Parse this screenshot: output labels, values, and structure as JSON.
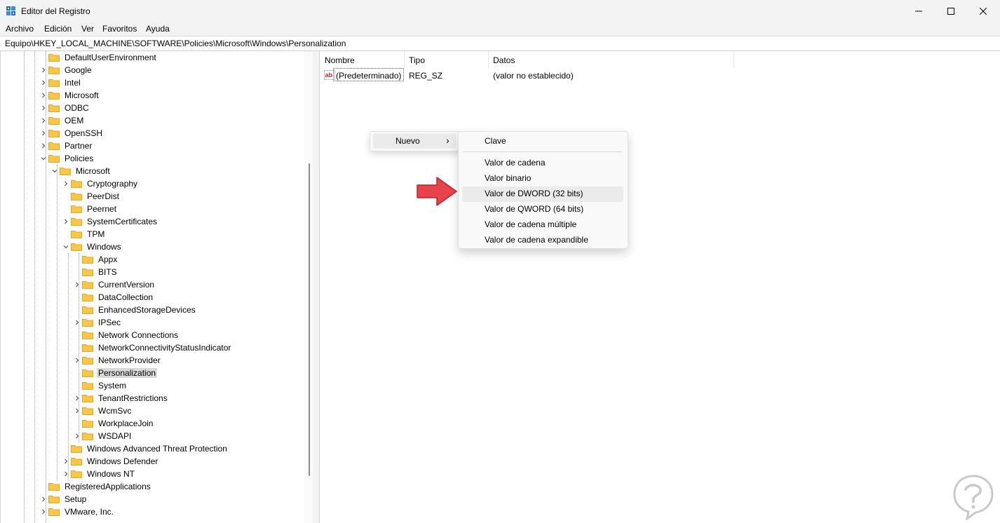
{
  "window": {
    "title": "Editor del Registro",
    "minimize": "—",
    "maximize": "☐",
    "close": "✕"
  },
  "menu": [
    "Archivo",
    "Edición",
    "Ver",
    "Favoritos",
    "Ayuda"
  ],
  "address": "Equipo\\HKEY_LOCAL_MACHINE\\SOFTWARE\\Policies\\Microsoft\\Windows\\Personalization",
  "tree": [
    {
      "label": "DefaultUserEnvironment",
      "level": 0,
      "expander": "none"
    },
    {
      "label": "Google",
      "level": 0,
      "expander": "collapsed"
    },
    {
      "label": "Intel",
      "level": 0,
      "expander": "collapsed"
    },
    {
      "label": "Microsoft",
      "level": 0,
      "expander": "collapsed"
    },
    {
      "label": "ODBC",
      "level": 0,
      "expander": "collapsed"
    },
    {
      "label": "OEM",
      "level": 0,
      "expander": "collapsed"
    },
    {
      "label": "OpenSSH",
      "level": 0,
      "expander": "collapsed"
    },
    {
      "label": "Partner",
      "level": 0,
      "expander": "collapsed"
    },
    {
      "label": "Policies",
      "level": 0,
      "expander": "expanded"
    },
    {
      "label": "Microsoft",
      "level": 1,
      "expander": "expanded"
    },
    {
      "label": "Cryptography",
      "level": 2,
      "expander": "collapsed"
    },
    {
      "label": "PeerDist",
      "level": 2,
      "expander": "none"
    },
    {
      "label": "Peernet",
      "level": 2,
      "expander": "none"
    },
    {
      "label": "SystemCertificates",
      "level": 2,
      "expander": "collapsed"
    },
    {
      "label": "TPM",
      "level": 2,
      "expander": "none"
    },
    {
      "label": "Windows",
      "level": 2,
      "expander": "expanded"
    },
    {
      "label": "Appx",
      "level": 3,
      "expander": "none"
    },
    {
      "label": "BITS",
      "level": 3,
      "expander": "none"
    },
    {
      "label": "CurrentVersion",
      "level": 3,
      "expander": "collapsed"
    },
    {
      "label": "DataCollection",
      "level": 3,
      "expander": "none"
    },
    {
      "label": "EnhancedStorageDevices",
      "level": 3,
      "expander": "none"
    },
    {
      "label": "IPSec",
      "level": 3,
      "expander": "collapsed"
    },
    {
      "label": "Network Connections",
      "level": 3,
      "expander": "none"
    },
    {
      "label": "NetworkConnectivityStatusIndicator",
      "level": 3,
      "expander": "none"
    },
    {
      "label": "NetworkProvider",
      "level": 3,
      "expander": "collapsed"
    },
    {
      "label": "Personalization",
      "level": 3,
      "expander": "none",
      "selected": true
    },
    {
      "label": "System",
      "level": 3,
      "expander": "none"
    },
    {
      "label": "TenantRestrictions",
      "level": 3,
      "expander": "collapsed"
    },
    {
      "label": "WcmSvc",
      "level": 3,
      "expander": "collapsed"
    },
    {
      "label": "WorkplaceJoin",
      "level": 3,
      "expander": "none"
    },
    {
      "label": "WSDAPI",
      "level": 3,
      "expander": "collapsed"
    },
    {
      "label": "Windows Advanced Threat Protection",
      "level": 2,
      "expander": "none"
    },
    {
      "label": "Windows Defender",
      "level": 2,
      "expander": "collapsed"
    },
    {
      "label": "Windows NT",
      "level": 2,
      "expander": "collapsed"
    },
    {
      "label": "RegisteredApplications",
      "level": 0,
      "expander": "none"
    },
    {
      "label": "Setup",
      "level": 0,
      "expander": "collapsed"
    },
    {
      "label": "VMware, Inc.",
      "level": 0,
      "expander": "collapsed"
    }
  ],
  "list": {
    "columns": [
      "Nombre",
      "Tipo",
      "Datos"
    ],
    "rows": [
      {
        "name": "(Predeterminado)",
        "type": "REG_SZ",
        "data": "(valor no establecido)",
        "icon": "string-value-icon"
      }
    ]
  },
  "context_menu": {
    "item": "Nuevo",
    "chevron": "›"
  },
  "submenu": {
    "items": [
      "Clave",
      "Valor de cadena",
      "Valor binario",
      "Valor de DWORD (32 bits)",
      "Valor de QWORD (64 bits)",
      "Valor de cadena múltiple",
      "Valor de cadena expandible"
    ],
    "highlighted": "Valor de DWORD (32 bits)"
  },
  "colors": {
    "folder": "#f8c74a",
    "folder_dark": "#e0a92a",
    "arrow": "#e8434a",
    "selection": "#d9d9d9",
    "icon_blue": "#1f6fc5"
  }
}
